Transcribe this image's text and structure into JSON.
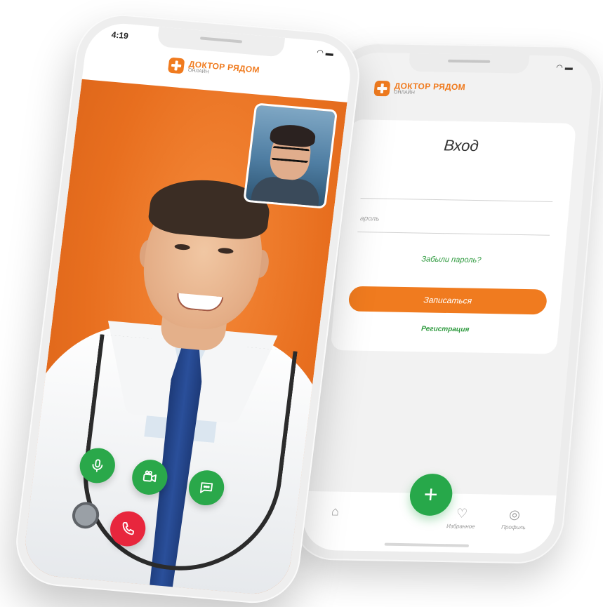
{
  "brand": {
    "name": "ДОКТОР РЯДОМ",
    "subtitle": "ОНЛАЙН",
    "accent_color": "#f07b1f",
    "green_color": "#2aa84a"
  },
  "call_screen": {
    "status_time": "4:19",
    "controls": [
      {
        "name": "microphone",
        "icon": "microphone-icon"
      },
      {
        "name": "camera",
        "icon": "video-camera-icon"
      },
      {
        "name": "chat",
        "icon": "chat-icon"
      },
      {
        "name": "end-call",
        "icon": "phone-icon"
      }
    ]
  },
  "login_screen": {
    "title": "Вход",
    "password_placeholder": "ароль",
    "forgot_password": "Забыли пароль?",
    "signup_button": "Записаться",
    "register_link": "Регистрация"
  },
  "tab_bar": {
    "add_icon": "plus-icon",
    "items": [
      {
        "label": "",
        "icon": "home-icon"
      },
      {
        "label": "Избранное",
        "icon": "heart-icon"
      },
      {
        "label": "Профиль",
        "icon": "profile-icon"
      }
    ]
  }
}
